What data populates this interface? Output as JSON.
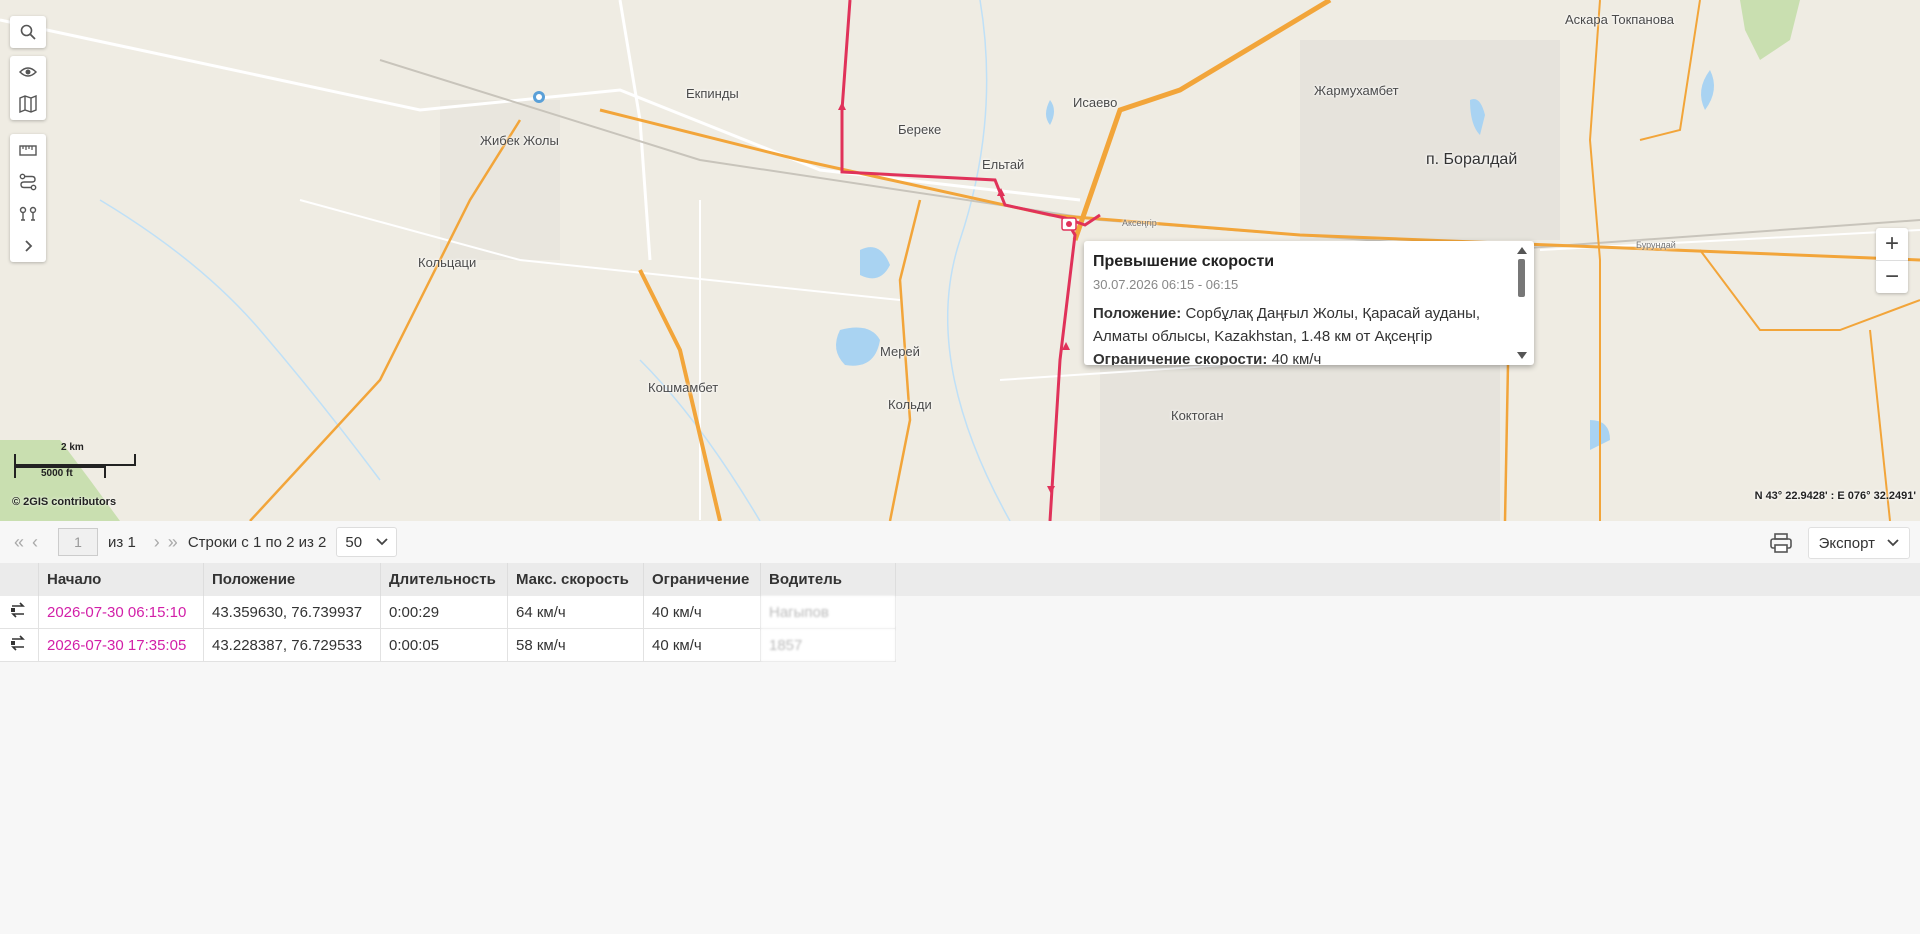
{
  "map": {
    "places": [
      {
        "name": "Екпинды"
      },
      {
        "name": "Жибек Жолы"
      },
      {
        "name": "Береке"
      },
      {
        "name": "Ельтай"
      },
      {
        "name": "Исаево"
      },
      {
        "name": "Жармухамбет"
      },
      {
        "name": "Аскара Токпанова"
      },
      {
        "name": "п. Боралдай"
      },
      {
        "name": "Кольцаци"
      },
      {
        "name": "Мерей"
      },
      {
        "name": "Кошмамбет"
      },
      {
        "name": "Кольди"
      },
      {
        "name": "Коктоган"
      },
      {
        "name": "Аксеңгір"
      },
      {
        "name": "Бурундай"
      }
    ],
    "scale_km": "2 km",
    "scale_ft": "5000 ft",
    "attribution": "© 2GIS contributors",
    "coordinates": "N 43° 22.9428' : E 076° 32.2491'",
    "zoom_in": "+",
    "zoom_out": "−",
    "route_color": "#e0325a"
  },
  "popup": {
    "title": "Превышение скорости",
    "time": "30.07.2026 06:15 - 06:15",
    "location_label": "Положение:",
    "location_value": "Сорбұлақ Даңғыл Жолы, Қарасай ауданы, Алматы облысы, Kazakhstan, 1.48 км от Ақсеңгір",
    "limit_label": "Ограничение скорости:",
    "limit_value": "40 км/ч"
  },
  "toolbar": {
    "current_page": "1",
    "of_pages": "из 1",
    "rows_info": "Строки с 1 по 2 из 2",
    "page_size": "50",
    "export_label": "Экспорт"
  },
  "table": {
    "columns": [
      "Начало",
      "Положение",
      "Длительность",
      "Макс. скорость",
      "Ограничение",
      "Водитель"
    ],
    "rows": [
      {
        "start": "2026-07-30 06:15:10",
        "position": "43.359630, 76.739937",
        "duration": "0:00:29",
        "max_speed": "64 км/ч",
        "limit": "40 км/ч",
        "driver": "Нагыпов"
      },
      {
        "start": "2026-07-30 17:35:05",
        "position": "43.228387, 76.729533",
        "duration": "0:00:05",
        "max_speed": "58 км/ч",
        "limit": "40 км/ч",
        "driver": "1857"
      }
    ]
  }
}
